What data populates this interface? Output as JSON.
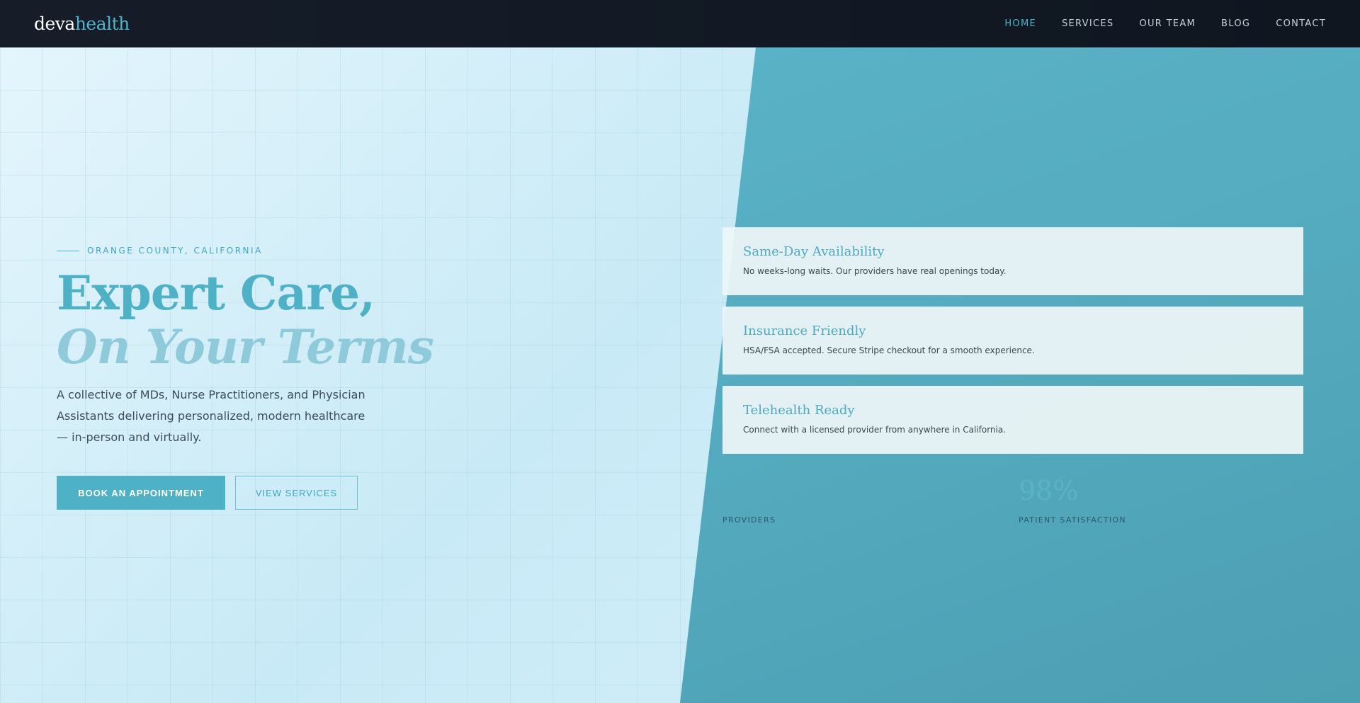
{
  "brand": {
    "part1": "deva",
    "part2": "health"
  },
  "nav": {
    "items": [
      {
        "label": "HOME",
        "active": true
      },
      {
        "label": "SERVICES"
      },
      {
        "label": "OUR TEAM"
      },
      {
        "label": "BLOG"
      },
      {
        "label": "CONTACT"
      }
    ]
  },
  "hero": {
    "eyebrow": "ORANGE COUNTY, CALIFORNIA",
    "title_line1": "Expert Care,",
    "title_line2": "On Your Terms",
    "description": "A collective of MDs, Nurse Practitioners, and Physician Assistants delivering personalized, modern healthcare — in-person and virtually.",
    "primary_button": "BOOK AN APPOINTMENT",
    "secondary_button": "VIEW SERVICES"
  },
  "features": [
    {
      "title": "Same-Day Availability",
      "desc": "No weeks-long waits. Our providers have real openings today."
    },
    {
      "title": "Insurance Friendly",
      "desc": "HSA/FSA accepted. Secure Stripe checkout for a smooth experience."
    },
    {
      "title": "Telehealth Ready",
      "desc": "Connect with a licensed provider from anywhere in California."
    }
  ],
  "stats": [
    {
      "value": "",
      "label": "PROVIDERS"
    },
    {
      "value": "98%",
      "label": "PATIENT SATISFACTION"
    }
  ],
  "colors": {
    "accent": "#4fb1c6",
    "nav_bg": "#111822",
    "panel": "#55abbf"
  }
}
